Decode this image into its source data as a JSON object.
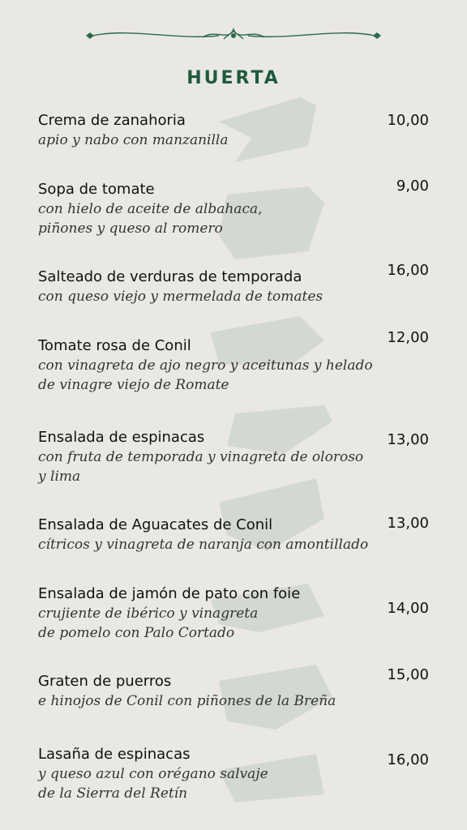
{
  "section_title": "HUERTA",
  "items": [
    {
      "name": "Crema de zanahoria",
      "desc": [
        "apio y nabo con manzanilla"
      ],
      "price": "10,00"
    },
    {
      "name": "Sopa de tomate",
      "desc": [
        "con hielo de aceite de albahaca,",
        "piñones y queso al romero"
      ],
      "price": "9,00"
    },
    {
      "name": "Salteado de verduras de temporada",
      "desc": [
        "con queso viejo y mermelada de tomates"
      ],
      "price": "16,00"
    },
    {
      "name": "Tomate rosa de Conil",
      "desc": [
        "con vinagreta de ajo negro y aceitunas y helado",
        "de vinagre viejo de Romate"
      ],
      "price": "12,00"
    },
    {
      "name": "Ensalada de espinacas",
      "desc": [
        "con fruta de temporada y vinagreta de oloroso",
        "y lima"
      ],
      "price": "13,00"
    },
    {
      "name": "Ensalada de Aguacates de Conil",
      "desc": [
        "cítricos y vinagreta de naranja con amontillado"
      ],
      "price": "13,00"
    },
    {
      "name": "Ensalada de jamón de pato con foie",
      "desc": [
        "crujiente de ibérico y vinagreta",
        "de pomelo con Palo Cortado"
      ],
      "price": "14,00"
    },
    {
      "name": "Graten de puerros",
      "desc": [
        "e hinojos de Conil con piñones de la Breña"
      ],
      "price": "15,00"
    },
    {
      "name": "Lasaña de espinacas",
      "desc": [
        "y queso azul con orégano salvaje",
        "de la Sierra del Retín"
      ],
      "price": "16,00"
    }
  ],
  "colors": {
    "background": "#e9e8e4",
    "accent": "#1f5a3c",
    "watermark": "#d3d8d2"
  }
}
